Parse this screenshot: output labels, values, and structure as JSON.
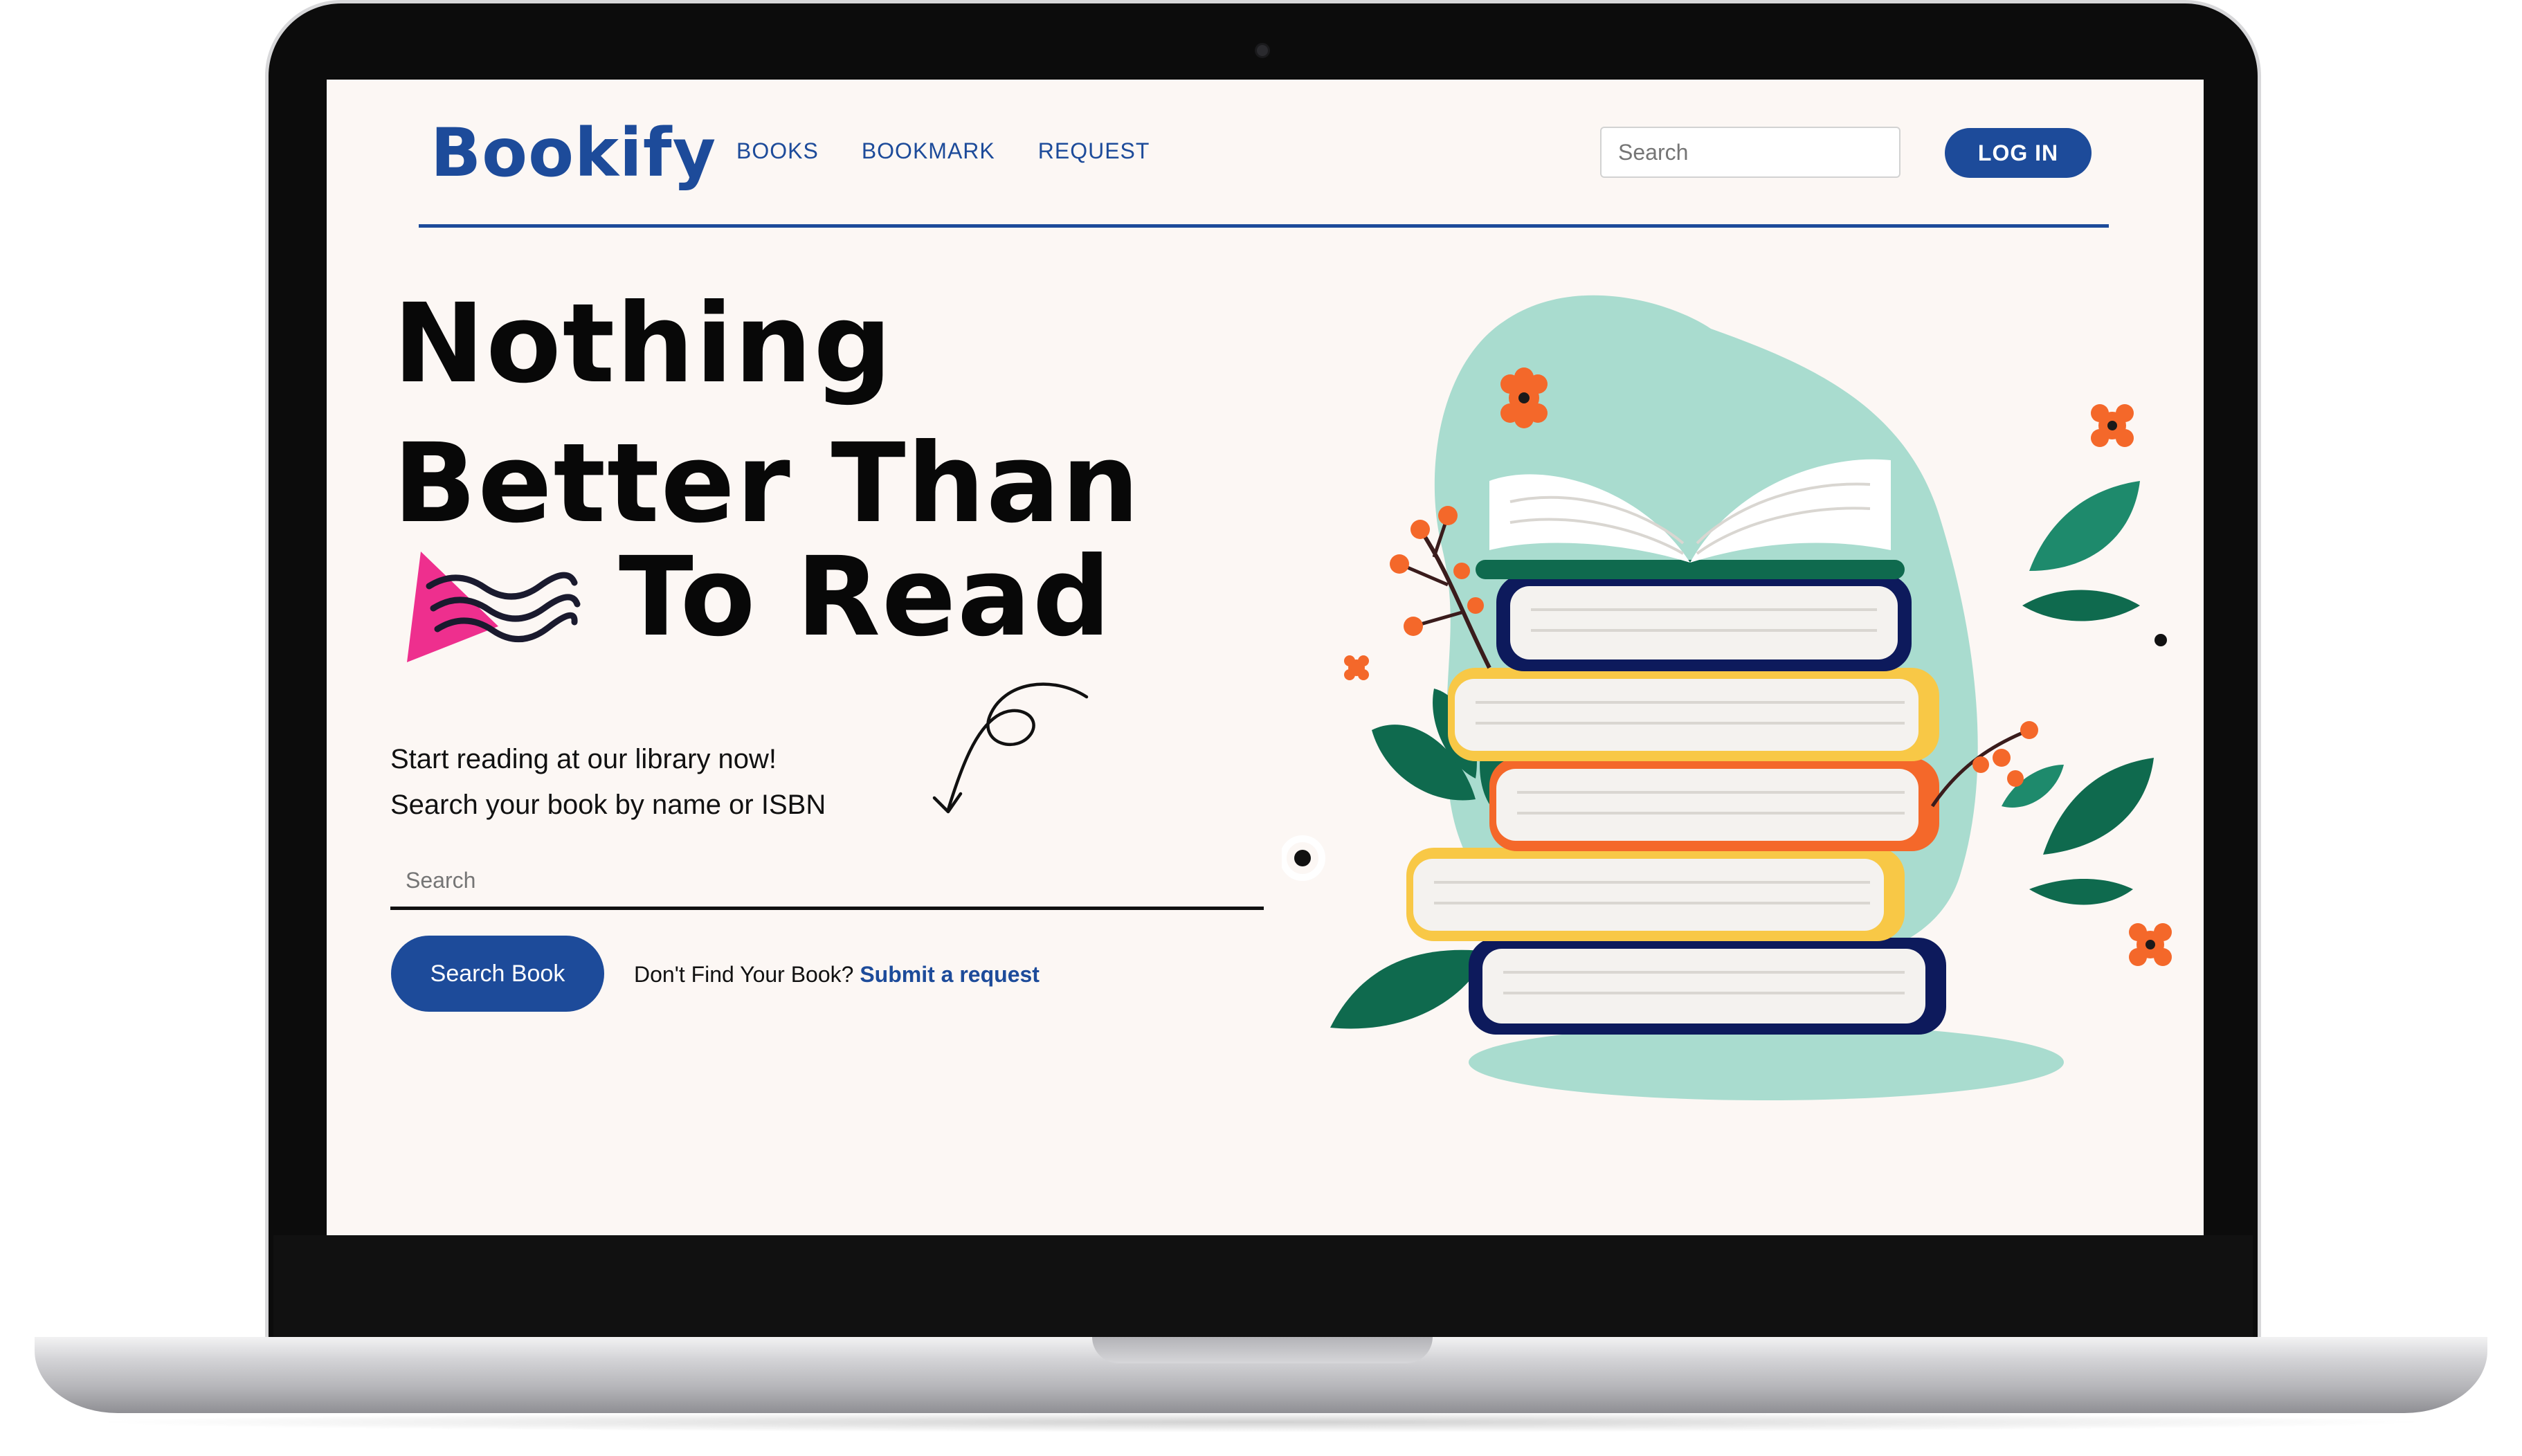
{
  "site": {
    "logo_text": "Bookify",
    "nav": [
      {
        "label": "BOOKS"
      },
      {
        "label": "BOOKMARK"
      },
      {
        "label": "REQUEST"
      }
    ],
    "header_search_placeholder": "Search",
    "login_label": "LOG IN"
  },
  "hero": {
    "line1": "Nothing",
    "line2": "Better Than",
    "line3": "To Read",
    "subtitle_line1": "Start reading at our library now!",
    "subtitle_line2": "Search your book by name or ISBN",
    "search_placeholder": "Search",
    "search_button_label": "Search Book",
    "request_prompt": "Don't Find Your Book?",
    "request_link": "Submit a request"
  },
  "colors": {
    "brand_blue": "#1d4b9a",
    "page_background": "#fcf7f4",
    "accent_pink": "#ee2f8e",
    "illustration_teal": "#9fd3c8",
    "illustration_orange": "#f4682a",
    "illustration_yellow": "#f8c846",
    "illustration_navy": "#0d1a5c",
    "illustration_green": "#0f6a4e"
  },
  "icons": {
    "swoosh": "pink-paper-plane-with-waves",
    "arrow_doodle": "curly-hand-drawn-arrow",
    "illustration": "stacked-books-with-open-book-and-plants"
  }
}
